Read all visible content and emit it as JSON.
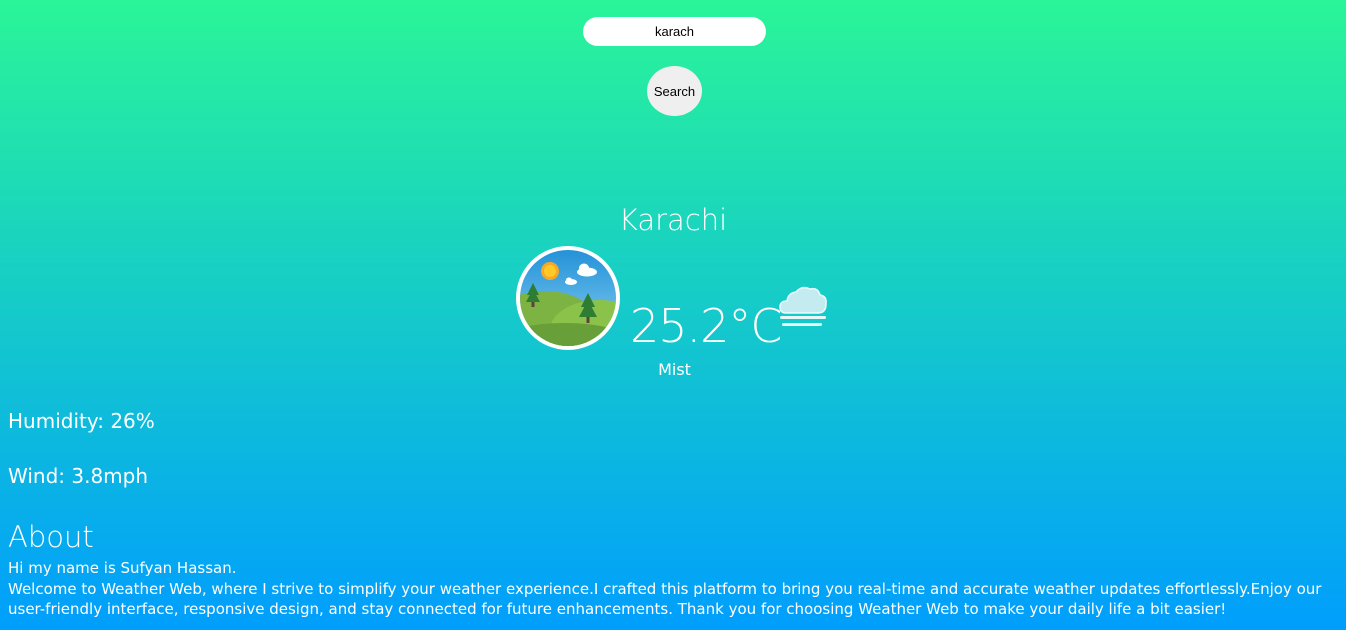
{
  "search": {
    "value": "karach",
    "button_label": "Search"
  },
  "weather": {
    "city": "Karachi",
    "temperature": "25.2°C",
    "condition": "Mist",
    "condition_icon": "mist-cloud-icon",
    "scene_image": "landscape-sun-hills-trees"
  },
  "stats": {
    "humidity": "Humidity: 26%",
    "wind": "Wind: 3.8mph"
  },
  "about": {
    "heading": "About",
    "greeting": "Hi my name is Sufyan Hassan.",
    "body": "Welcome to Weather Web, where I strive to simplify your weather experience.I crafted this platform to bring you real-time and accurate weather updates effortlessly.Enjoy our user-friendly interface, responsive design, and stay connected for future enhancements. Thank you for choosing Weather Web to make your daily life a bit easier!"
  },
  "colors": {
    "gradient_top": "#2af598",
    "gradient_bottom": "#009efd",
    "text": "#ffffff"
  }
}
